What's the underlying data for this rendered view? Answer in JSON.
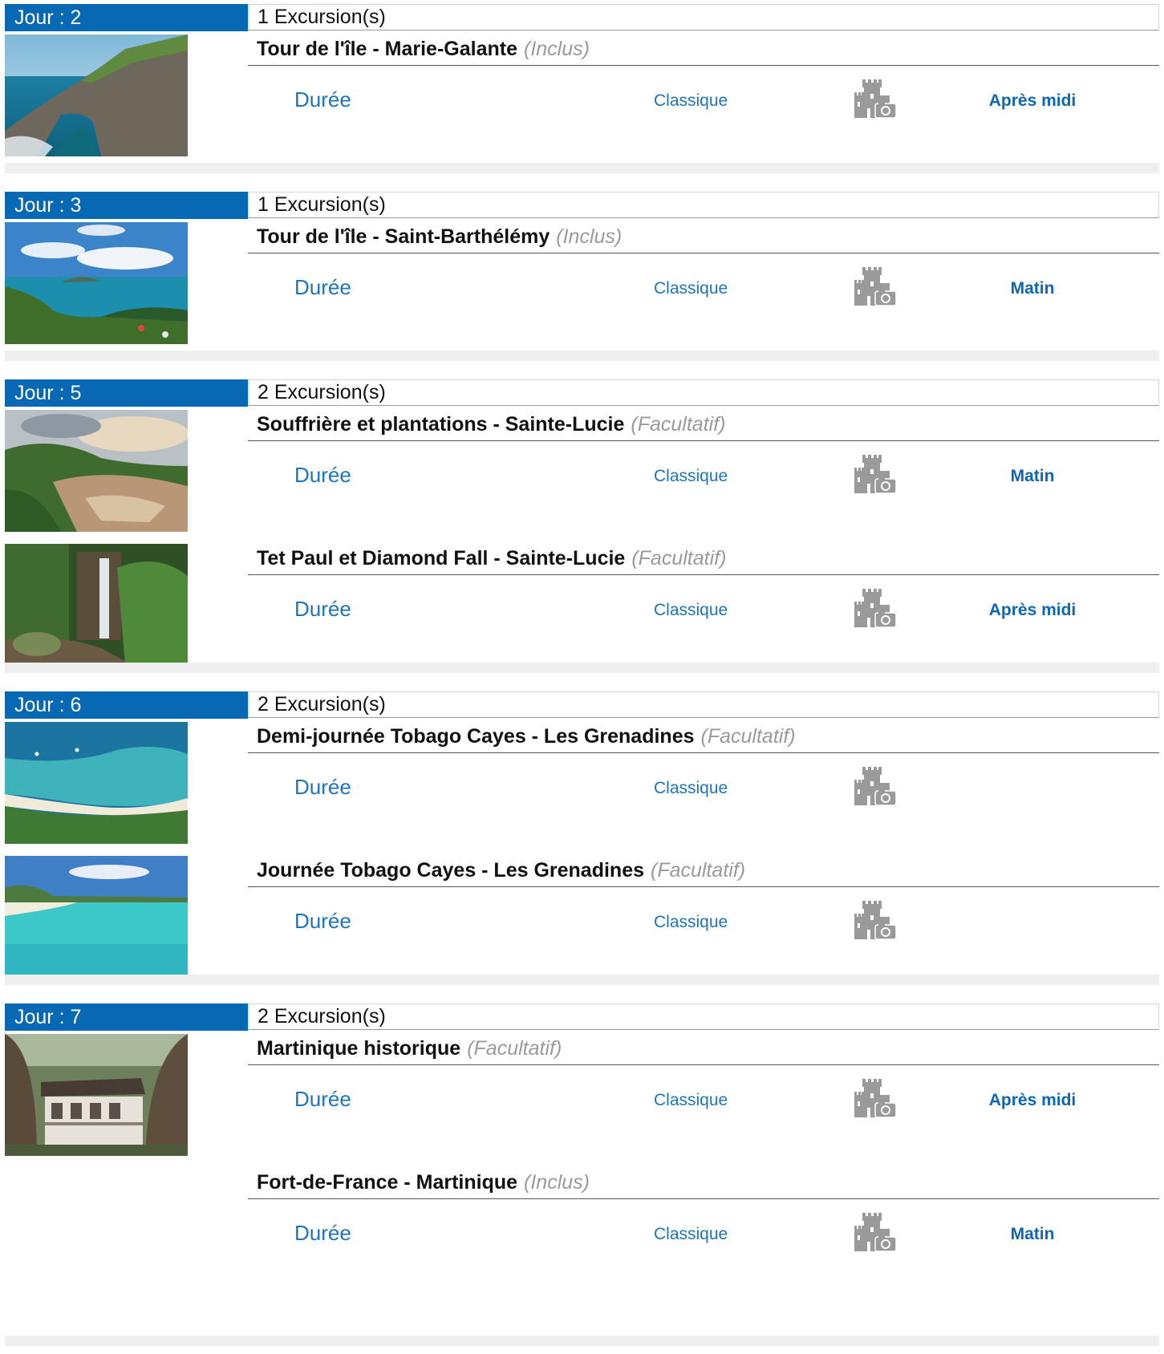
{
  "days": [
    {
      "label": "Jour : 2",
      "count": "1 Excursion(s)",
      "excursions": [
        {
          "name": "Tour de l'île - Marie-Galante",
          "tag": "(Inclus)",
          "duree": "Durée",
          "category": "Classique",
          "period": "Après midi",
          "scene": "cliff"
        }
      ]
    },
    {
      "label": "Jour : 3",
      "count": "1 Excursion(s)",
      "excursions": [
        {
          "name": "Tour de l'île - Saint-Barthélémy",
          "tag": "(Inclus)",
          "duree": "Durée",
          "category": "Classique",
          "period": "Matin",
          "scene": "bay"
        }
      ]
    },
    {
      "label": "Jour : 5",
      "count": "2 Excursion(s)",
      "excursions": [
        {
          "name": "Souffrière et plantations - Sainte-Lucie",
          "tag": "(Facultatif)",
          "duree": "Durée",
          "category": "Classique",
          "period": "Matin",
          "scene": "volcano"
        },
        {
          "name": "Tet Paul et Diamond Fall - Sainte-Lucie",
          "tag": "(Facultatif)",
          "duree": "Durée",
          "category": "Classique",
          "period": "Après midi",
          "scene": "waterfall"
        }
      ]
    },
    {
      "label": "Jour : 6",
      "count": "2 Excursion(s)",
      "excursions": [
        {
          "name": "Demi-journée Tobago Cayes - Les Grenadines",
          "tag": "(Facultatif)",
          "duree": "Durée",
          "category": "Classique",
          "period": "",
          "scene": "aerial"
        },
        {
          "name": "Journée Tobago Cayes - Les Grenadines",
          "tag": "(Facultatif)",
          "duree": "Durée",
          "category": "Classique",
          "period": "",
          "scene": "lagoon"
        }
      ]
    },
    {
      "label": "Jour : 7",
      "count": "2 Excursion(s)",
      "excursions": [
        {
          "name": "Martinique historique",
          "tag": "(Facultatif)",
          "duree": "Durée",
          "category": "Classique",
          "period": "Après midi",
          "scene": "house"
        },
        {
          "name": "Fort-de-France - Martinique",
          "tag": "(Inclus)",
          "duree": "Durée",
          "category": "Classique",
          "period": "Matin",
          "scene": ""
        }
      ]
    }
  ],
  "icons": {
    "category_icon": "castle-camera-icon"
  },
  "colors": {
    "day_label_bg": "#0769b4",
    "link_blue": "#1e74bd",
    "tag_gray": "#9a9a9a",
    "separator": "#efefef"
  }
}
